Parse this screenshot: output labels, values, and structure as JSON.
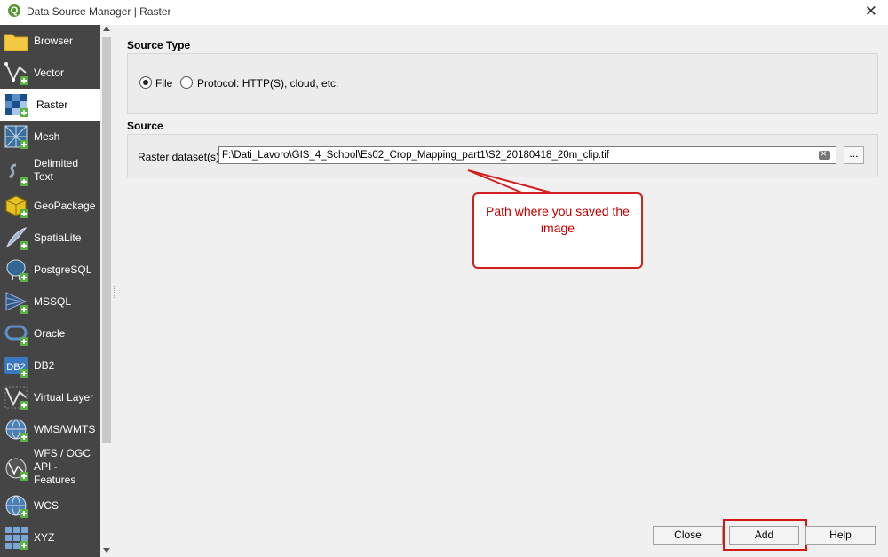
{
  "window": {
    "title": "Data Source Manager | Raster",
    "app_icon": "qgis-icon",
    "close_glyph": "✕"
  },
  "sidebar": {
    "items": [
      {
        "label": "Browser",
        "icon": "folder-icon",
        "selected": false
      },
      {
        "label": "Vector",
        "icon": "vector-icon",
        "selected": false
      },
      {
        "label": "Raster",
        "icon": "raster-icon",
        "selected": true
      },
      {
        "label": "Mesh",
        "icon": "mesh-icon",
        "selected": false
      },
      {
        "label": "Delimited Text",
        "icon": "delimited-text-icon",
        "selected": false
      },
      {
        "label": "GeoPackage",
        "icon": "geopackage-icon",
        "selected": false
      },
      {
        "label": "SpatiaLite",
        "icon": "spatialite-icon",
        "selected": false
      },
      {
        "label": "PostgreSQL",
        "icon": "postgresql-icon",
        "selected": false
      },
      {
        "label": "MSSQL",
        "icon": "mssql-icon",
        "selected": false
      },
      {
        "label": "Oracle",
        "icon": "oracle-icon",
        "selected": false
      },
      {
        "label": "DB2",
        "icon": "db2-icon",
        "selected": false
      },
      {
        "label": "Virtual Layer",
        "icon": "virtual-layer-icon",
        "selected": false
      },
      {
        "label": "WMS/WMTS",
        "icon": "wms-icon",
        "selected": false
      },
      {
        "label": "WFS / OGC API - Features",
        "icon": "wfs-icon",
        "selected": false
      },
      {
        "label": "WCS",
        "icon": "wcs-icon",
        "selected": false
      },
      {
        "label": "XYZ",
        "icon": "xyz-icon",
        "selected": false
      }
    ]
  },
  "source_type": {
    "title": "Source Type",
    "file_label": "File",
    "protocol_label": "Protocol: HTTP(S), cloud, etc.",
    "selected": "File"
  },
  "source": {
    "title": "Source",
    "dataset_label": "Raster dataset(s)",
    "dataset_value": "F:\\Dati_Lavoro\\GIS_4_School\\Es02_Crop_Mapping_part1\\S2_20180418_20m_clip.tif",
    "browse_label": "..."
  },
  "annotation": {
    "text": "Path where you saved the image",
    "color": "#c00000"
  },
  "buttons": {
    "close": "Close",
    "add": "Add",
    "help": "Help"
  },
  "colors": {
    "sidebar_bg": "#454545",
    "accent_green": "#589632",
    "annotation_red": "#d02020"
  }
}
